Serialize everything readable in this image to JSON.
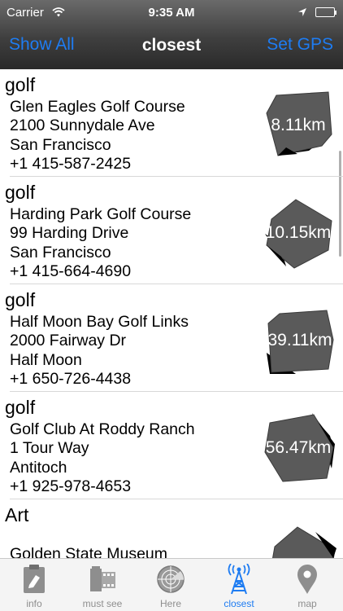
{
  "status_bar": {
    "carrier": "Carrier",
    "time": "9:35 AM"
  },
  "nav": {
    "left_button": "Show All",
    "title": "closest",
    "right_button": "Set GPS"
  },
  "places": [
    {
      "category": "golf",
      "name": "Glen Eagles Golf Course",
      "address": "2100 Sunnydale Ave",
      "city": "San Francisco",
      "phone": "+1 415-587-2425",
      "distance": "8.11km"
    },
    {
      "category": "golf",
      "name": "Harding Park Golf Course",
      "address": "99 Harding Drive",
      "city": "San Francisco",
      "phone": "+1 415-664-4690",
      "distance": "10.15km"
    },
    {
      "category": "golf",
      "name": "Half Moon Bay Golf Links",
      "address": "2000 Fairway Dr",
      "city": "Half Moon",
      "phone": "+1 650-726-4438",
      "distance": "39.11km"
    },
    {
      "category": "golf",
      "name": "Golf Club At Roddy Ranch",
      "address": "1 Tour Way",
      "city": "Antitoch",
      "phone": "+1 925-978-4653",
      "distance": "56.47km"
    },
    {
      "category": "Art",
      "name": "Golden State Museum",
      "address": "",
      "city": "",
      "phone": "",
      "distance": ""
    }
  ],
  "tabs": [
    {
      "label": "info",
      "icon": "clipboard-icon",
      "active": false
    },
    {
      "label": "must see",
      "icon": "film-roll-icon",
      "active": false
    },
    {
      "label": "Here",
      "icon": "radar-icon",
      "active": false
    },
    {
      "label": "closest",
      "icon": "antenna-tower-icon",
      "active": true
    },
    {
      "label": "map",
      "icon": "map-pin-icon",
      "active": false
    }
  ],
  "colors": {
    "accent": "#1e7cf2",
    "badge": "#5a5a5a",
    "tab_inactive": "#8e8e8e"
  }
}
